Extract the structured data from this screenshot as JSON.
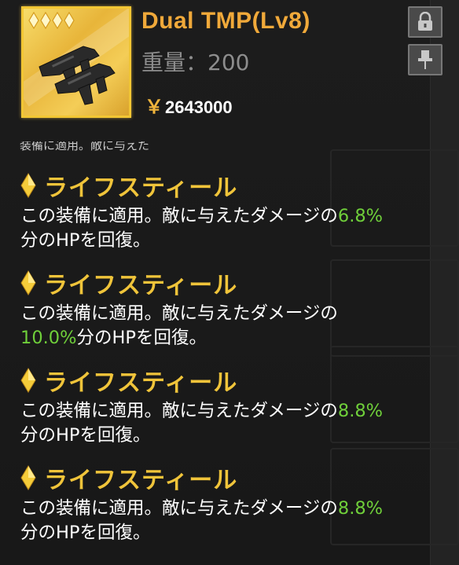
{
  "item": {
    "name": "Dual TMP(Lv8)",
    "weight": "重量：200",
    "price_symbol": "￥",
    "price": "2643000",
    "rarity_stars": 4,
    "icon": "smg-weapon-icon"
  },
  "buttons": {
    "lock_icon": "lock-icon",
    "pin_icon": "pin-icon"
  },
  "cut_text": "装備に適用。敵に与えた",
  "skills": [
    {
      "name": "ライフスティール",
      "line1_pre": "この装備に適用。敵に与えたダメージの",
      "line1_pct": "6.8%",
      "line2_pct": "",
      "line2_post": "分のHPを回復。"
    },
    {
      "name": "ライフスティール",
      "line1_pre": "この装備に適用。敵に与えたダメージの",
      "line1_pct": "",
      "line2_pct": "10.0%",
      "line2_post": "分のHPを回復。"
    },
    {
      "name": "ライフスティール",
      "line1_pre": "この装備に適用。敵に与えたダメージの",
      "line1_pct": "8.8%",
      "line2_pct": "",
      "line2_post": "分のHPを回復。"
    },
    {
      "name": "ライフスティール",
      "line1_pre": "この装備に適用。敵に与えたダメージの",
      "line1_pct": "8.8%",
      "line2_pct": "",
      "line2_post": "分のHPを回復。"
    }
  ],
  "colors": {
    "title": "#f0a93a",
    "skill_name": "#f0c43a",
    "percent": "#6fcf3a",
    "frame_gold": "#f2c634"
  }
}
